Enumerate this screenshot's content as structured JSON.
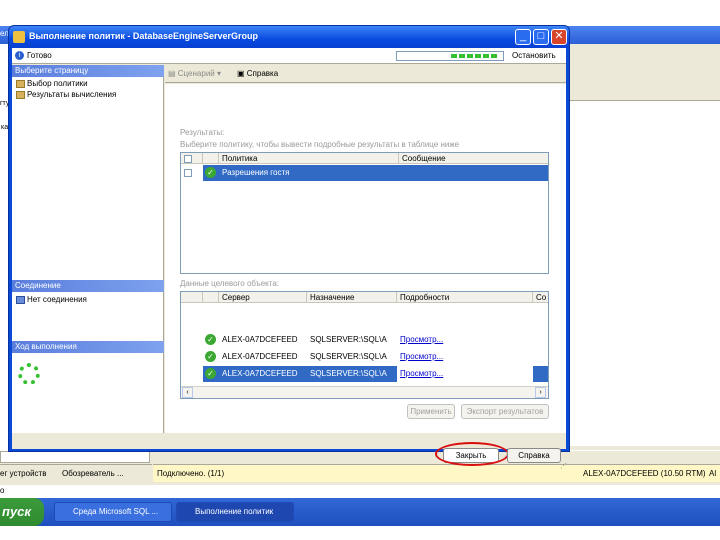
{
  "dialog": {
    "title": "Выполнение политик - DatabaseEngineServerGroup",
    "status_text": "Готово",
    "stop_label": "Остановить",
    "left_header": "Выберите страницу",
    "nav_items": [
      "Выбор политики",
      "Результаты вычисления"
    ],
    "connection_header": "Соединение",
    "connection_item": "Нет соединения",
    "progress_header": "Ход выполнения",
    "toolbar_script": "Сценарий",
    "toolbar_help": "Справка",
    "results_title": "Результаты:",
    "results_hint": "Выберите политику, чтобы вывести подробные результаты в таблице ниже",
    "policy_grid": {
      "headers": [
        "",
        "",
        "Политика",
        "Сообщение"
      ],
      "rows": [
        {
          "policy": "Разрешения гостя",
          "message": ""
        }
      ]
    },
    "target_details_title": "Данные целевого объекта:",
    "target_grid": {
      "headers": [
        "",
        "",
        "Сервер",
        "Назначение",
        "Подробности",
        "Со"
      ],
      "rows": [
        {
          "server": "ALEX-0A7DCEFEED",
          "target": "SQLSERVER:\\SQL\\A",
          "details": "Просмотр..."
        },
        {
          "server": "ALEX-0A7DCEFEED",
          "target": "SQLSERVER:\\SQL\\A",
          "details": "Просмотр..."
        },
        {
          "server": "ALEX-0A7DCEFEED",
          "target": "SQLSERVER:\\SQL\\A",
          "details": "Просмотр..."
        }
      ]
    },
    "apply_label": "Применить",
    "export_label": "Экспорт результатов",
    "close_label": "Закрыть",
    "help_label": "Справка"
  },
  "background": {
    "status_connected": "Подключено. (1/1)",
    "status_server": "ALEX-0A7DCEFEED (10.50 RTM)",
    "status_tail": "Al",
    "tab_devices": "ег устройств",
    "tab_explorer": "Обозреватель ...",
    "left_bits": [
      "ел",
      "гту",
      "ка"
    ],
    "status_o": "o"
  },
  "taskbar": {
    "start_label": "пуск",
    "tasks": [
      "Среда Microsoft SQL ...",
      "Выполнение политик"
    ]
  },
  "colors": {
    "selection": "#316ac5",
    "highlight_circle": "#d90f0f",
    "window_blue": "#0a49d6",
    "success_green": "#3aa832"
  }
}
